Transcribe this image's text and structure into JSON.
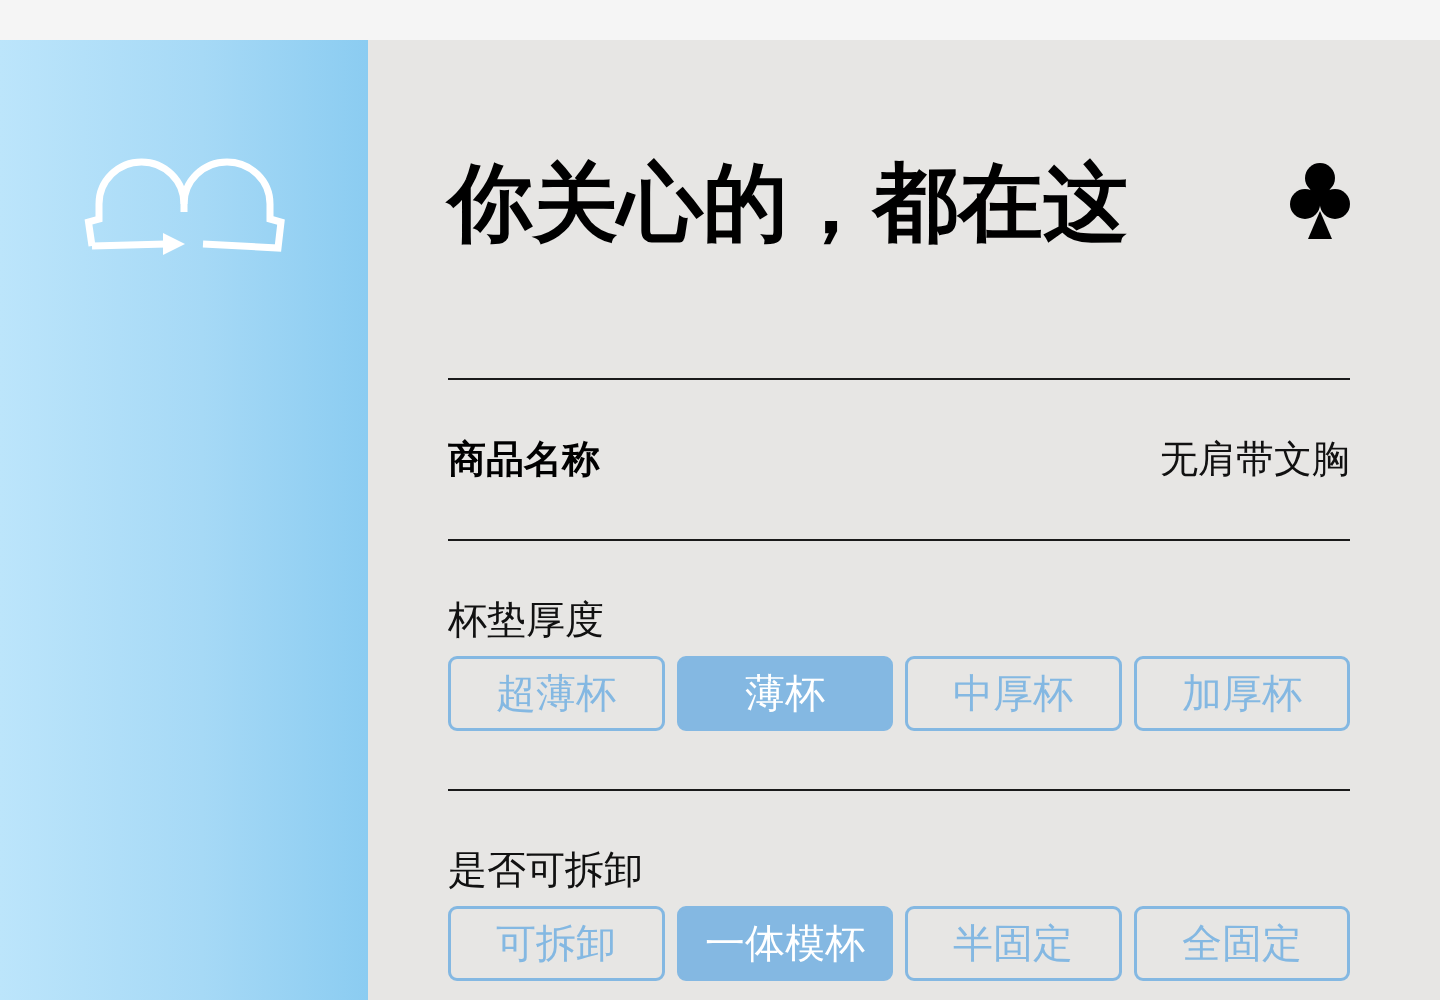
{
  "title": "你关心的，都在这",
  "product": {
    "label": "商品名称",
    "value": "无肩带文胸"
  },
  "option_groups": [
    {
      "label": "杯垫厚度",
      "options": [
        {
          "label": "超薄杯",
          "selected": false
        },
        {
          "label": "薄杯",
          "selected": true
        },
        {
          "label": "中厚杯",
          "selected": false
        },
        {
          "label": "加厚杯",
          "selected": false
        }
      ]
    },
    {
      "label": "是否可拆卸",
      "options": [
        {
          "label": "可拆卸",
          "selected": false
        },
        {
          "label": "一体模杯",
          "selected": true
        },
        {
          "label": "半固定",
          "selected": false
        },
        {
          "label": "全固定",
          "selected": false
        }
      ]
    }
  ]
}
